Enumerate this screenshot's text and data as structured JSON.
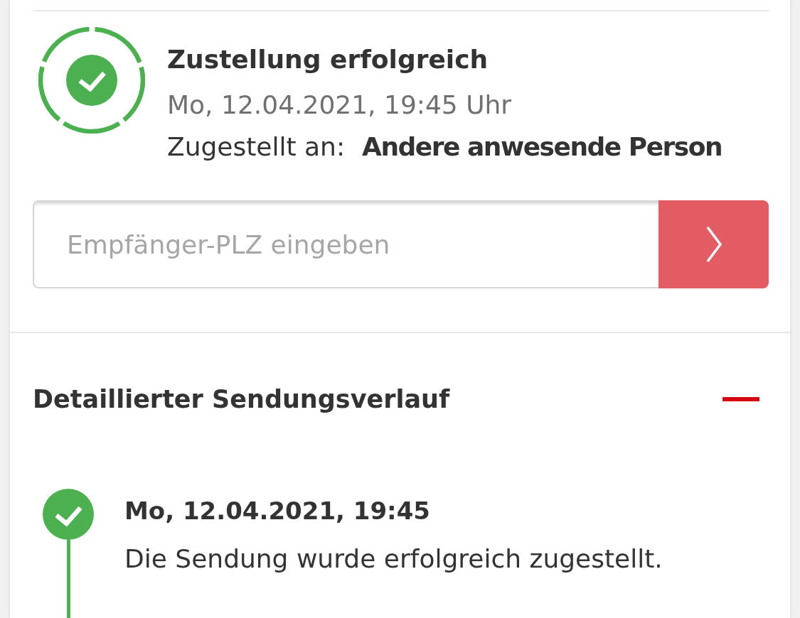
{
  "delivery": {
    "delivered": true,
    "title": "Zustellung erfolgreich",
    "timestamp": "Mo, 12.04.2021, 19:45 Uhr",
    "recipient_label": "Zugestellt an:",
    "recipient": "Andere anwesende Person"
  },
  "postcode_search": {
    "placeholder": "Empfänger-PLZ eingeben"
  },
  "history": {
    "title": "Detaillierter Sendungsverlauf",
    "expanded": true,
    "events": [
      {
        "completed": true,
        "time": "Mo, 12.04.2021, 19:45",
        "description": "Die Sendung wurde erfolgreich zugestellt."
      }
    ]
  }
}
